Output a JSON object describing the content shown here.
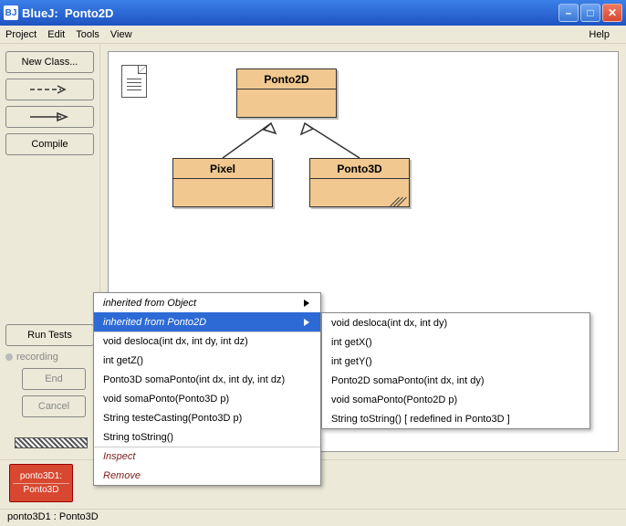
{
  "window": {
    "app_name": "BlueJ",
    "project": "Ponto2D"
  },
  "menus": {
    "project": "Project",
    "edit": "Edit",
    "tools": "Tools",
    "view": "View",
    "help": "Help"
  },
  "buttons": {
    "new_class": "New Class...",
    "compile": "Compile",
    "run_tests": "Run Tests",
    "recording": "recording",
    "end": "End",
    "cancel": "Cancel"
  },
  "classes": {
    "ponto2d": "Ponto2D",
    "pixel": "Pixel",
    "ponto3d": "Ponto3D"
  },
  "object": {
    "name": "ponto3D1:",
    "type": "Ponto3D"
  },
  "status": "ponto3D1 : Ponto3D",
  "context": {
    "inherited_object": "inherited from Object",
    "inherited_ponto2d": "inherited from Ponto2D",
    "items": [
      "void desloca(int dx, int dy, int dz)",
      "int getZ()",
      "Ponto3D somaPonto(int dx, int dy, int dz)",
      "void somaPonto(Ponto3D p)",
      "String testeCasting(Ponto3D p)",
      "String toString()"
    ],
    "inspect": "Inspect",
    "remove": "Remove"
  },
  "submenu": {
    "items": [
      "void desloca(int dx, int dy)",
      "int getX()",
      "int getY()",
      "Ponto2D somaPonto(int dx, int dy)",
      "void somaPonto(Ponto2D p)",
      "String toString()   [ redefined in Ponto3D ]"
    ]
  },
  "icons": {
    "app": "BJ"
  }
}
